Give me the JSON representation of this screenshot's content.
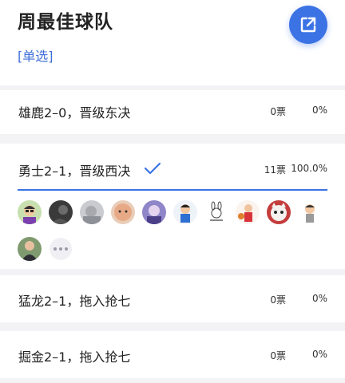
{
  "header": {
    "title": "周最佳球队",
    "subtitle": "[单选]",
    "share_icon": "share-external-icon",
    "accent_color": "#3b73e4"
  },
  "options": [
    {
      "label": "雄鹿2–0，晋级东决",
      "votes": "0票",
      "percent": "0%",
      "selected": false,
      "progress": 0
    },
    {
      "label": "勇士2–1，晋级西决",
      "votes": "11票",
      "percent": "100.0%",
      "selected": true,
      "progress": 1.0
    },
    {
      "label": "猛龙2–1，拖入抢七",
      "votes": "0票",
      "percent": "0%",
      "selected": false,
      "progress": 0
    },
    {
      "label": "掘金2–1，拖入抢七",
      "votes": "0票",
      "percent": "0%",
      "selected": false,
      "progress": 0
    }
  ],
  "voters": {
    "avatars": [
      "avatar-cartoon-green",
      "avatar-dark-photo",
      "avatar-gray-photo",
      "avatar-baby-face",
      "avatar-purple-glow",
      "avatar-blue-cartoon",
      "avatar-rabbit-sketch",
      "avatar-basketball-player",
      "avatar-white-cat",
      "avatar-cartoon-boy",
      "avatar-suited-man"
    ],
    "more_icon": "more-dots-icon"
  }
}
